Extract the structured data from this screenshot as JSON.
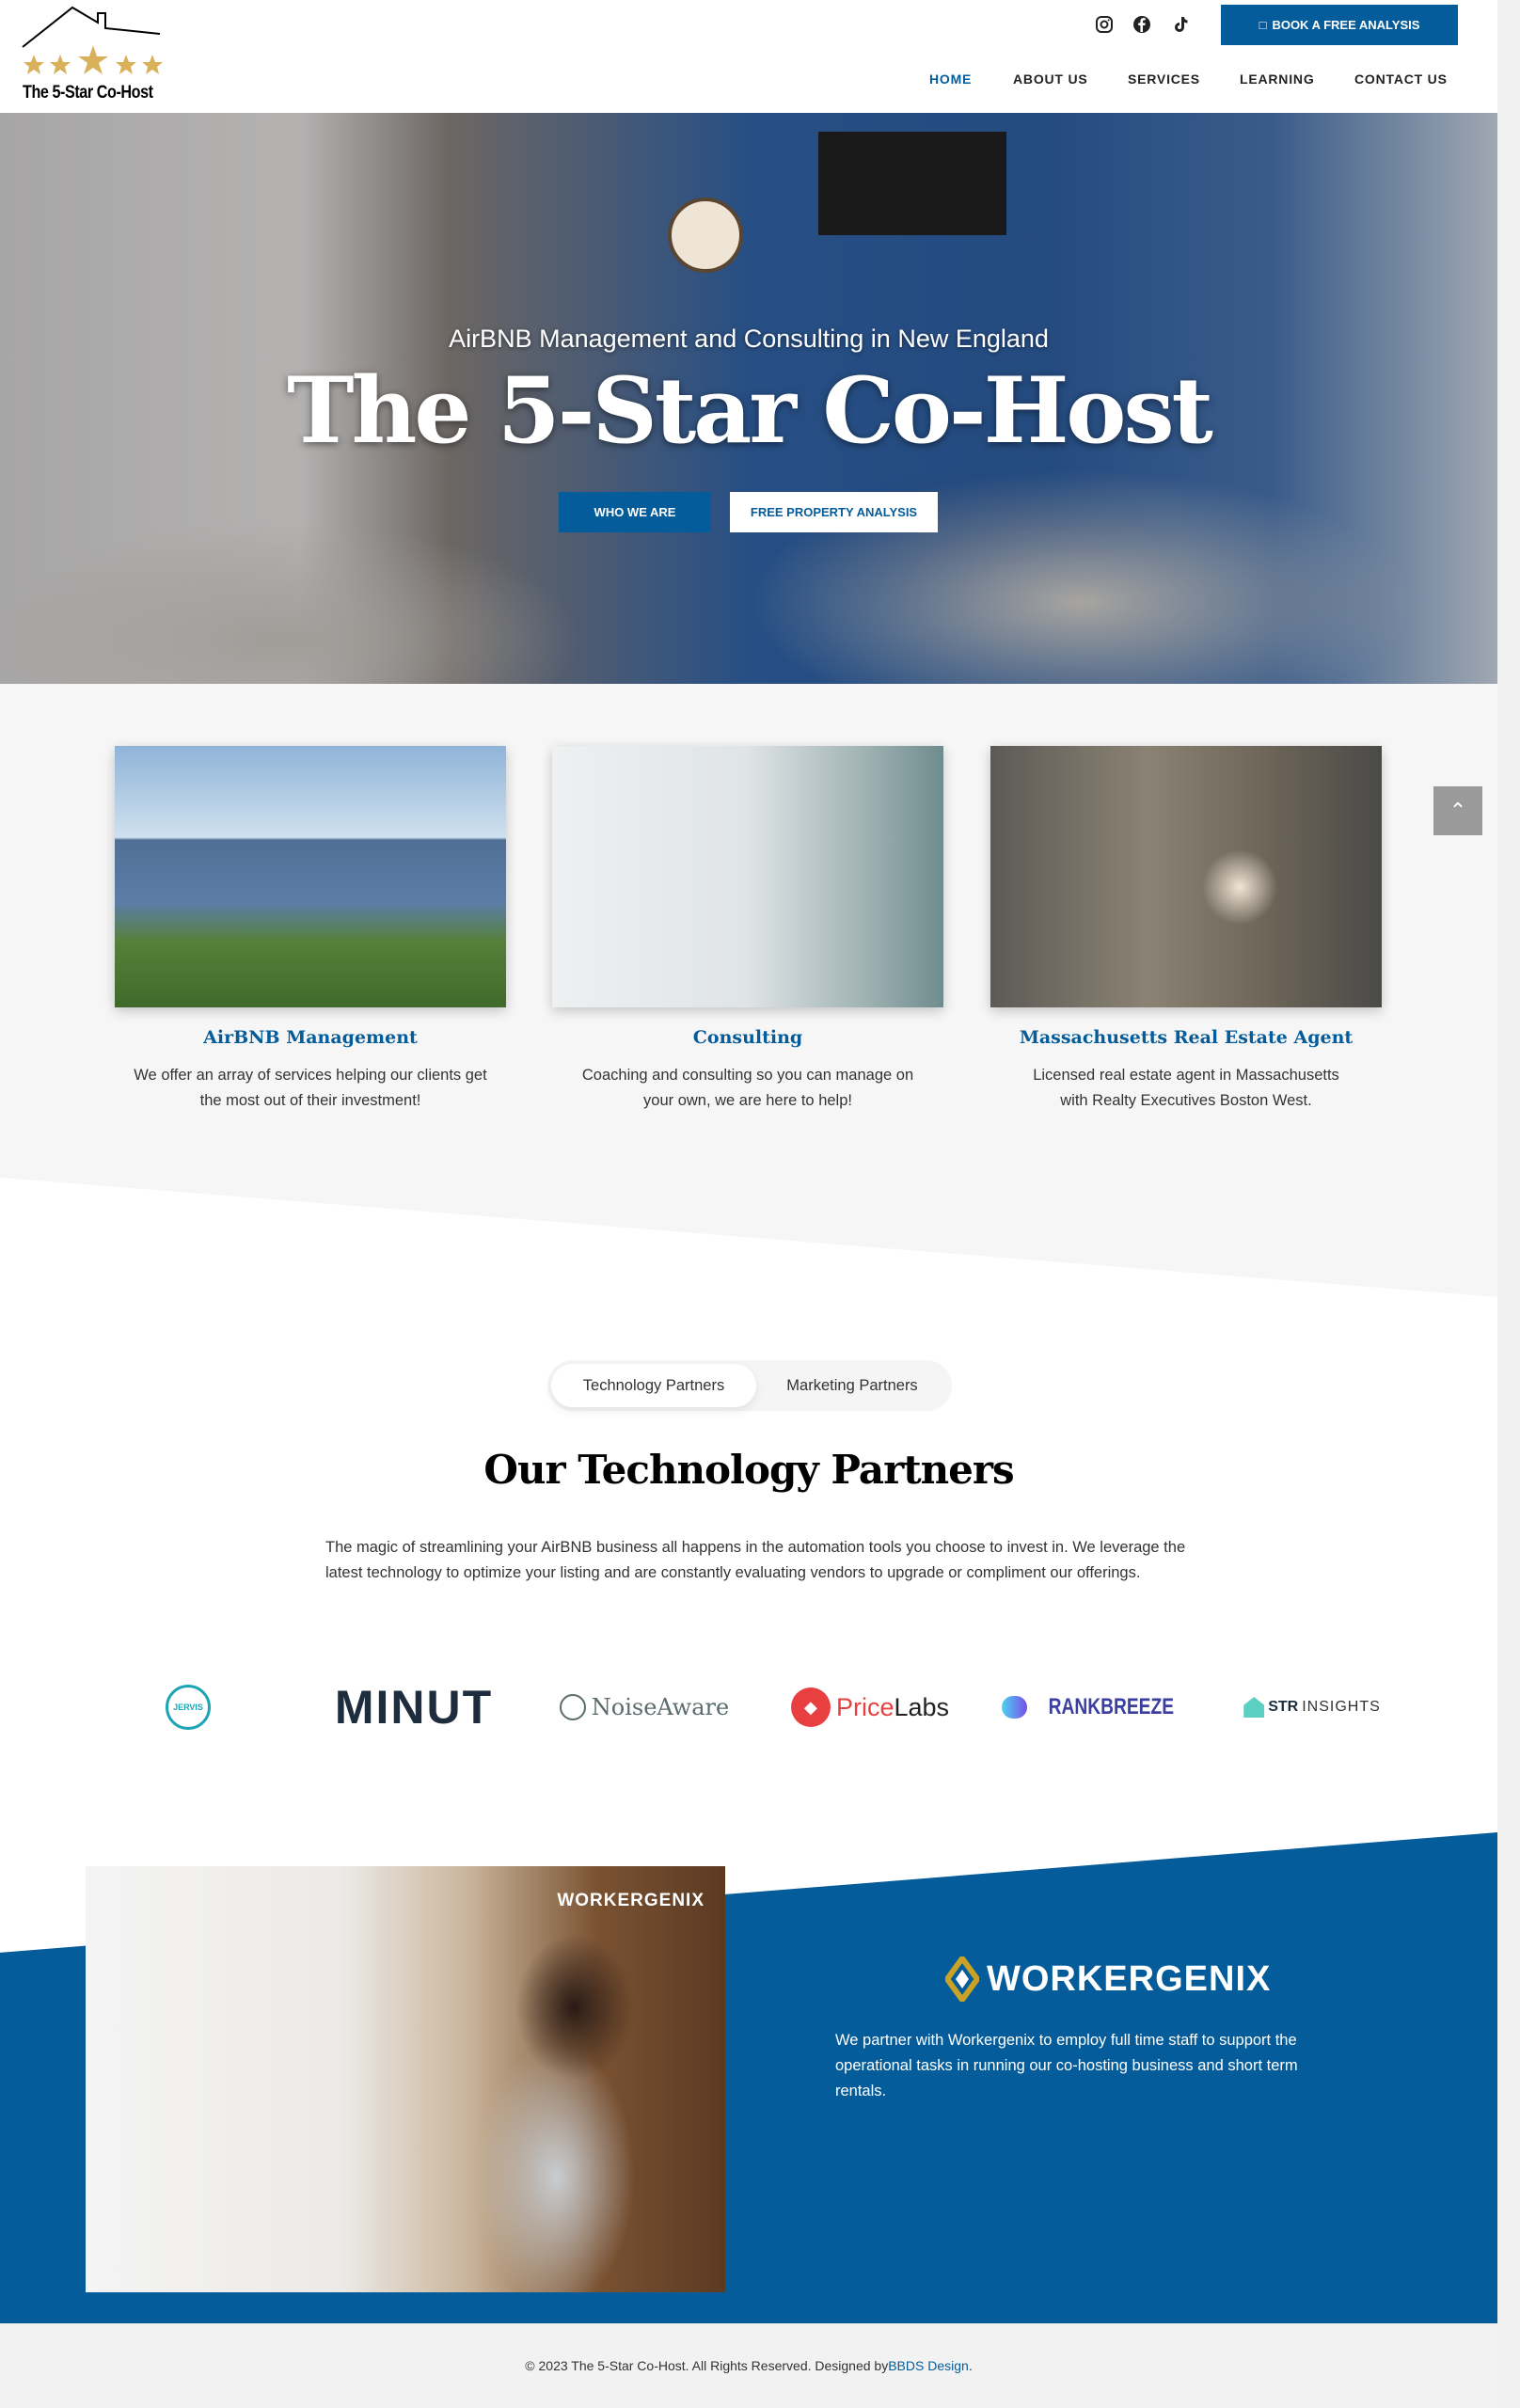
{
  "colors": {
    "brand": "#045c9a",
    "gold": "#c9a227"
  },
  "header": {
    "logo_text": "The 5-Star Co-Host",
    "social": [
      {
        "icon": "instagram-icon"
      },
      {
        "icon": "facebook-icon"
      },
      {
        "icon": "tiktok-icon"
      }
    ],
    "book_button": "BOOK A FREE ANALYSIS",
    "nav": [
      {
        "label": "HOME",
        "active": true
      },
      {
        "label": "ABOUT US"
      },
      {
        "label": "SERVICES"
      },
      {
        "label": "LEARNING"
      },
      {
        "label": "CONTACT US"
      }
    ]
  },
  "hero": {
    "subtitle": "AirBNB Management and Consulting in New England",
    "title": "The 5-Star Co-Host",
    "buttons": [
      "WHO WE ARE",
      "FREE PROPERTY ANALYSIS"
    ]
  },
  "services": [
    {
      "title": "AirBNB Management",
      "desc": "We offer an array of services helping our clients get the most out of their investment!"
    },
    {
      "title": "Consulting",
      "desc": "Coaching and consulting so you can manage on your own, we are here to help!"
    },
    {
      "title": "Massachusetts Real Estate Agent",
      "desc": "Licensed real estate agent in Massachusetts with Realty Executives Boston West."
    }
  ],
  "partners": {
    "tabs": [
      "Technology Partners",
      "Marketing Partners"
    ],
    "heading": "Our Technology Partners",
    "description": "The magic of streamlining your AirBNB business all happens in the automation tools you choose to invest in. We leverage the latest technology to optimize your listing and are constantly evaluating vendors to upgrade or compliment our offerings.",
    "logos": [
      "JERVIS",
      "MINUT",
      "NoiseAware",
      "Price",
      "Labs",
      "RANKBREEZE",
      "STR",
      "INSIGHTS"
    ]
  },
  "workergenix": {
    "photo_logo": "WORKERGENIX",
    "logo": "WORKERGENIX",
    "text": "We partner with Workergenix to employ full time staff to support the operational tasks in running our co-hosting business and short term rentals."
  },
  "footer": {
    "text": "© 2023 The 5-Star Co-Host. All Rights Reserved. Designed by ",
    "link": "BBDS Design",
    "end": "."
  }
}
